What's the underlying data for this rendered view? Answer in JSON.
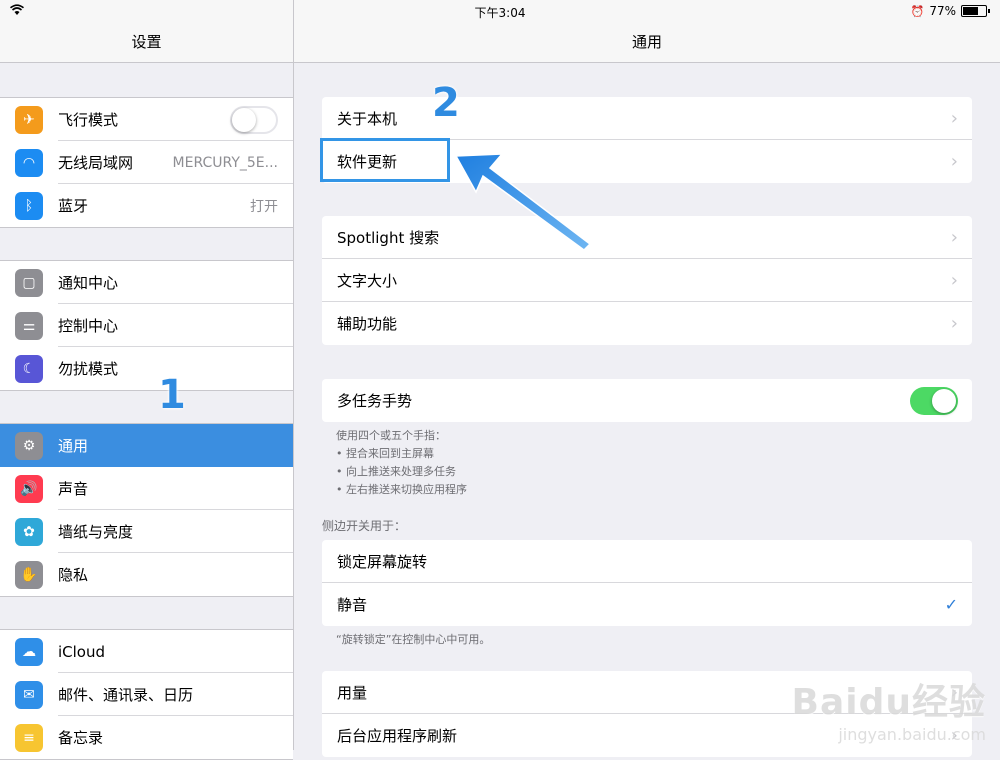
{
  "status_bar": {
    "time": "下午3:04",
    "battery": "77%"
  },
  "sidebar": {
    "title": "设置",
    "groups": [
      [
        {
          "label": "飞行模式",
          "icon": "airplane-icon",
          "color": "#f49b1c",
          "control": "toggle-off"
        },
        {
          "label": "无线局域网",
          "icon": "wifi-icon",
          "color": "#1c8cf2",
          "value": "MERCURY_5E..."
        },
        {
          "label": "蓝牙",
          "icon": "bluetooth-icon",
          "color": "#1c8cf2",
          "value": "打开"
        }
      ],
      [
        {
          "label": "通知中心",
          "icon": "notification-center-icon",
          "color": "#8e8e93"
        },
        {
          "label": "控制中心",
          "icon": "control-center-icon",
          "color": "#8e8e93"
        },
        {
          "label": "勿扰模式",
          "icon": "moon-icon",
          "color": "#5856d6"
        }
      ],
      [
        {
          "label": "通用",
          "icon": "gear-icon",
          "color": "#8e8e93",
          "selected": true
        },
        {
          "label": "声音",
          "icon": "speaker-icon",
          "color": "#ff3b50"
        },
        {
          "label": "墙纸与亮度",
          "icon": "flower-icon",
          "color": "#2fa8d8"
        },
        {
          "label": "隐私",
          "icon": "hand-icon",
          "color": "#8e8e93"
        }
      ],
      [
        {
          "label": "iCloud",
          "icon": "cloud-icon",
          "color": "#2f8fe8"
        },
        {
          "label": "邮件、通讯录、日历",
          "icon": "mail-icon",
          "color": "#2f8fe8"
        },
        {
          "label": "备忘录",
          "icon": "notes-icon",
          "color": "#f7c531"
        }
      ]
    ]
  },
  "main": {
    "title": "通用",
    "group1": [
      "关于本机",
      "软件更新"
    ],
    "group2": [
      "Spotlight 搜索",
      "文字大小",
      "辅助功能"
    ],
    "multitask": {
      "label": "多任务手势",
      "toggle": "on"
    },
    "multitask_footer": [
      "使用四个或五个手指：",
      "• 捏合来回到主屏幕",
      "• 向上推送来处理多任务",
      "• 左右推送来切换应用程序"
    ],
    "side_switch_header": "侧边开关用于：",
    "side_switch_rows": [
      {
        "label": "锁定屏幕旋转",
        "checked": false
      },
      {
        "label": "静音",
        "checked": true
      }
    ],
    "side_switch_footer": "“旋转锁定”在控制中心中可用。",
    "group5": [
      "用量",
      "后台应用程序刷新"
    ]
  },
  "annotations": {
    "step1": "1",
    "step2": "2",
    "accent": "#2f8be0"
  },
  "watermark": {
    "brand": "Baidu经验",
    "url": "jingyan.baidu.com"
  }
}
